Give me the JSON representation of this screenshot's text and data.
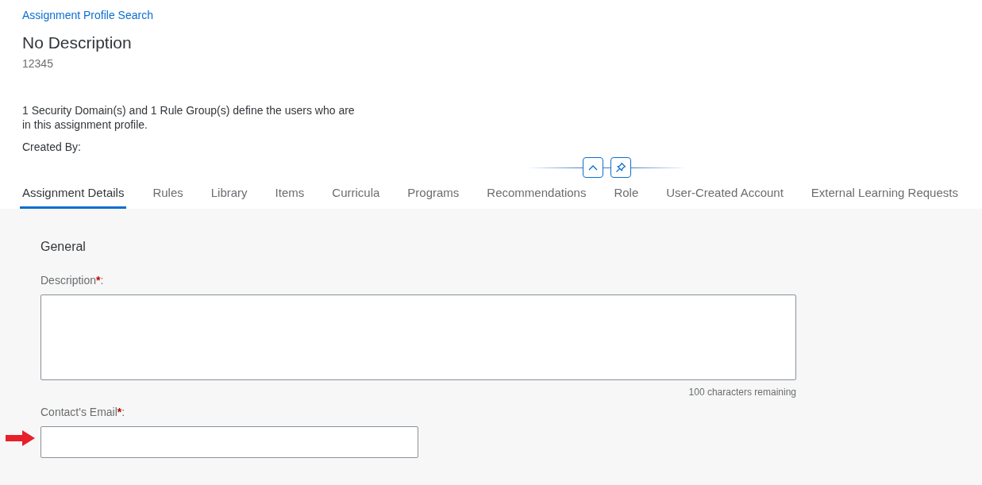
{
  "breadcrumb": "Assignment Profile Search",
  "title": "No Description",
  "subtitle": "12345",
  "summary": "1 Security Domain(s) and 1 Rule Group(s) define the users who are in this assignment profile.",
  "created_by": "Created By:",
  "tabs": [
    {
      "label": "Assignment Details",
      "selected": true
    },
    {
      "label": "Rules",
      "selected": false
    },
    {
      "label": "Library",
      "selected": false
    },
    {
      "label": "Items",
      "selected": false
    },
    {
      "label": "Curricula",
      "selected": false
    },
    {
      "label": "Programs",
      "selected": false
    },
    {
      "label": "Recommendations",
      "selected": false
    },
    {
      "label": "Role",
      "selected": false
    },
    {
      "label": "User-Created Account",
      "selected": false
    },
    {
      "label": "External Learning Requests",
      "selected": false
    }
  ],
  "section": {
    "title": "General",
    "fields": [
      {
        "kind": "textarea",
        "label": "Description",
        "required_mark": "*",
        "label_end": ":",
        "counter": "100 characters remaining",
        "highlighted": false
      },
      {
        "kind": "input",
        "label": "Contact's Email",
        "required_mark": "*",
        "label_end": ":",
        "highlighted": true
      }
    ]
  }
}
